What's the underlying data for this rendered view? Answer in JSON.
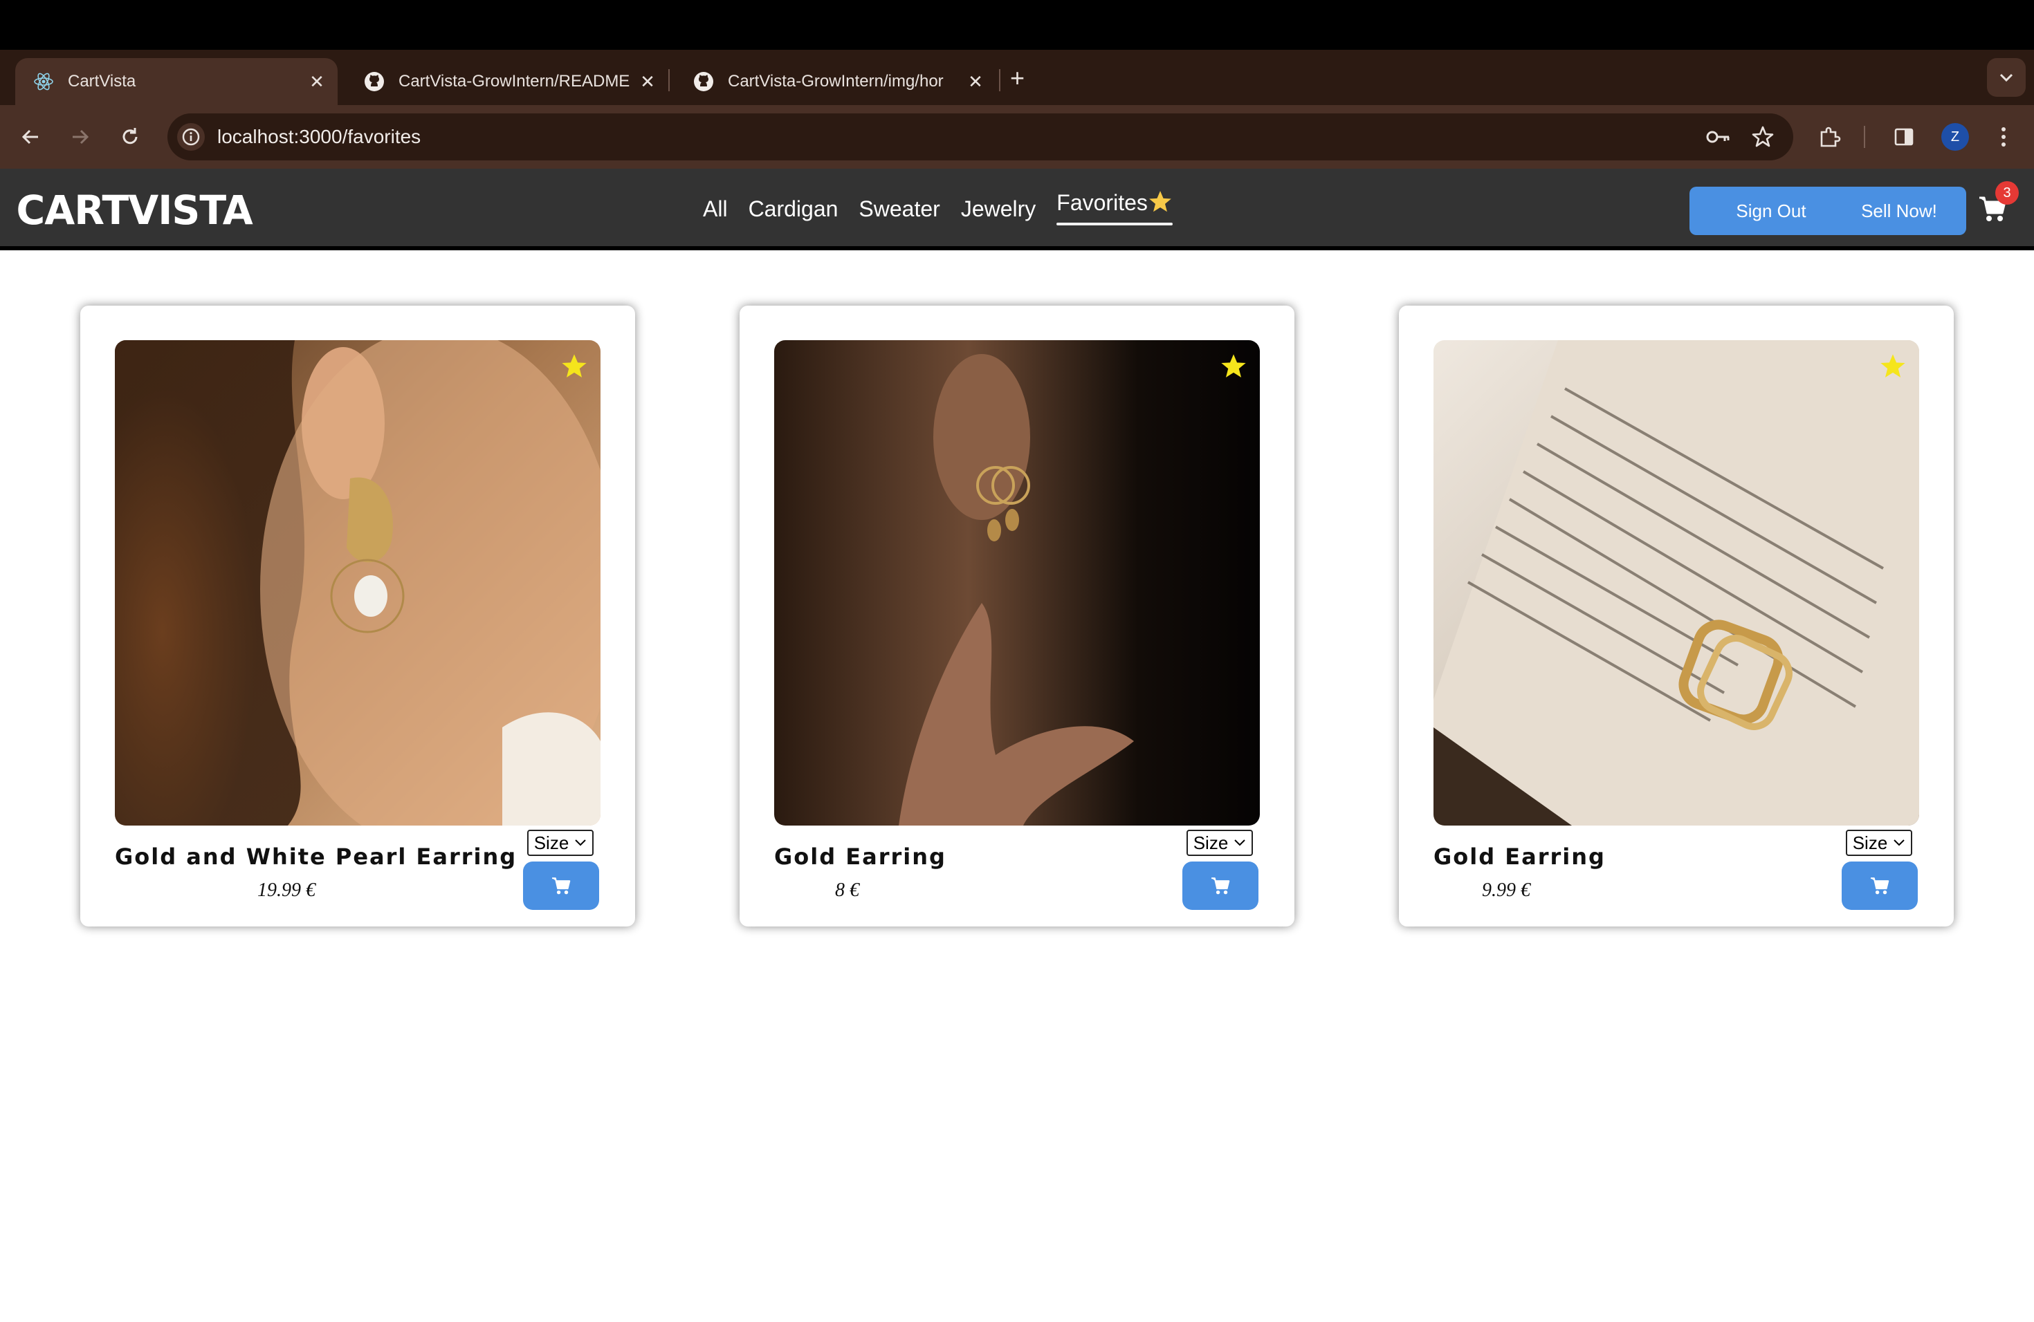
{
  "browser": {
    "tabs": [
      {
        "title": "CartVista",
        "icon": "react-icon",
        "active": true
      },
      {
        "title": "CartVista-GrowIntern/README",
        "icon": "github-icon",
        "active": false
      },
      {
        "title": "CartVista-GrowIntern/img/hor",
        "icon": "github-icon",
        "active": false
      }
    ],
    "url": "localhost:3000/favorites",
    "profile_initial": "Z"
  },
  "nav": {
    "logo": "CARTVISTA",
    "links": [
      "All",
      "Cardigan",
      "Sweater",
      "Jewelry"
    ],
    "favorites_label": "Favorites",
    "sign_out": "Sign Out",
    "sell_now": "Sell Now!",
    "cart_count": "3"
  },
  "products": [
    {
      "name": "Gold and White Pearl Earring",
      "price": "19.99 €",
      "size_label": "Size",
      "favorited": true
    },
    {
      "name": "Gold Earring",
      "price": "8 €",
      "size_label": "Size",
      "favorited": true
    },
    {
      "name": "Gold Earring",
      "price": "9.99 €",
      "size_label": "Size",
      "favorited": true
    }
  ],
  "colors": {
    "accent": "#4a90e2",
    "nav_bg": "#333333",
    "browser_bg": "#2c1a12",
    "star": "#f5e51c"
  }
}
